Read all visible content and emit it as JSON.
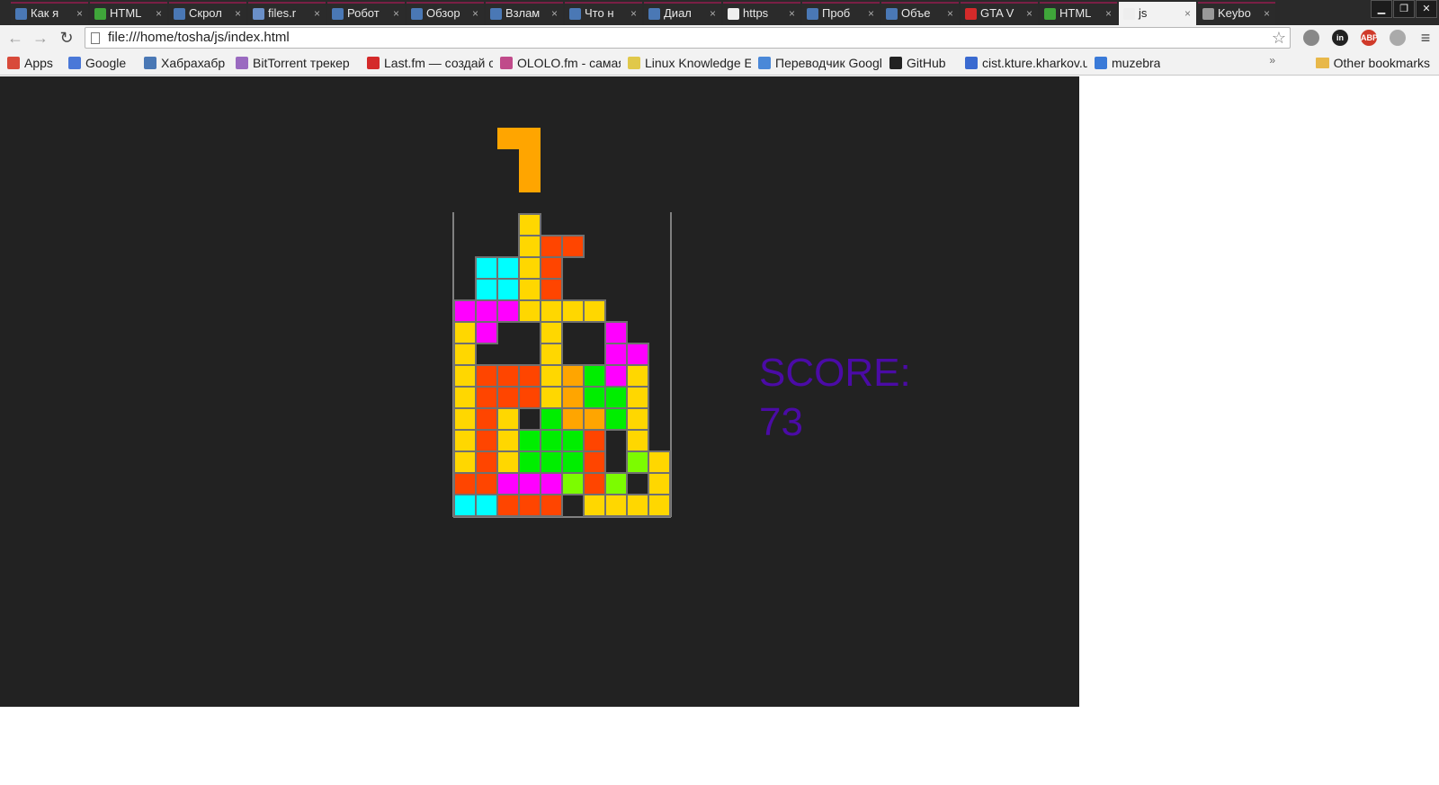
{
  "browser": {
    "tabs": [
      {
        "label": "Как я",
        "icon": "habr-icon",
        "color": "#4a78b5"
      },
      {
        "label": "HTML",
        "icon": "html-icon",
        "color": "#3fa63a"
      },
      {
        "label": "Скрол",
        "icon": "habr-icon",
        "color": "#4a78b5"
      },
      {
        "label": "files.r",
        "icon": "files-icon",
        "color": "#6a8fc7"
      },
      {
        "label": "Робот",
        "icon": "habr-icon",
        "color": "#4a78b5"
      },
      {
        "label": "Обзор",
        "icon": "habr-icon",
        "color": "#4a78b5"
      },
      {
        "label": "Взлам",
        "icon": "habr-icon",
        "color": "#4a78b5"
      },
      {
        "label": "Что н",
        "icon": "habr-icon",
        "color": "#4a78b5"
      },
      {
        "label": "Диал",
        "icon": "trello-icon",
        "color": "#4a78b5"
      },
      {
        "label": "https",
        "icon": "page-icon",
        "color": "#eeeeee"
      },
      {
        "label": "Проб",
        "icon": "habr-icon",
        "color": "#4a78b5"
      },
      {
        "label": "Объе",
        "icon": "habr-icon",
        "color": "#4a78b5"
      },
      {
        "label": "GTA V",
        "icon": "youtube-icon",
        "color": "#d42a2a"
      },
      {
        "label": "HTML",
        "icon": "html-icon",
        "color": "#3fa63a"
      },
      {
        "label": "js",
        "icon": "page-icon",
        "color": "#eeeeee",
        "active": true
      },
      {
        "label": "Keybo",
        "icon": "book-icon",
        "color": "#999999"
      }
    ],
    "url": "file:///home/tosha/js/index.html",
    "bookmarks": [
      {
        "label": "Apps",
        "icon": "apps-icon",
        "color": "#d84a3a"
      },
      {
        "label": "Google",
        "icon": "google-icon",
        "color": "#4a78d8"
      },
      {
        "label": "Хабрахабр",
        "icon": "habr-icon",
        "color": "#4a78b5"
      },
      {
        "label": "BitTorrent трекер",
        "icon": "torrent-icon",
        "color": "#9a6ac0"
      },
      {
        "label": "Last.fm — создай с",
        "icon": "lastfm-icon",
        "color": "#d42a2a"
      },
      {
        "label": "OLOLO.fm - самая",
        "icon": "ololo-icon",
        "color": "#c04a8a"
      },
      {
        "label": "Linux Knowledge E",
        "icon": "document-icon",
        "color": "#e0c84a"
      },
      {
        "label": "Переводчик Googl",
        "icon": "translate-icon",
        "color": "#4a88d8"
      },
      {
        "label": "GitHub",
        "icon": "github-icon",
        "color": "#222222"
      },
      {
        "label": "cist.kture.kharkov.u",
        "icon": "cist-icon",
        "color": "#3a6ad0"
      },
      {
        "label": "muzebra",
        "icon": "muzebra-icon",
        "color": "#3a7ad8"
      }
    ],
    "other_bookmarks": "Other bookmarks",
    "bookmarks_label": "Apps",
    "extensions": [
      {
        "name": "ghostery-icon",
        "text": "",
        "color": "#888888"
      },
      {
        "name": "linkedin-icon",
        "text": "in",
        "color": "#222222"
      },
      {
        "name": "adblock-icon",
        "text": "ABP",
        "color": "#d03a2a"
      },
      {
        "name": "ghost-icon",
        "text": "",
        "color": "#aaaaaa"
      }
    ]
  },
  "game": {
    "score_label": "SCORE:",
    "score_value": "73",
    "colors": {
      "Y": "#ffd700",
      "R": "#ff4500",
      "O": "#ffa500",
      "G": "#00ee00",
      "L": "#7cfc00",
      "M": "#ff00ff",
      "C": "#00ffff",
      "well_border": "#808080",
      "cell_stroke": "#707070",
      "score": "#4b0ba6",
      "background": "#222222"
    },
    "board": [
      "..........",
      "..........",
      "..........",
      "..........",
      "..........",
      "..........",
      "..........",
      "...Y......",
      "...YRR....",
      ".CCYR.....",
      ".CCYR.....",
      "MMMYYYY...",
      "YM..Y..M..",
      "Y...Y..MM.",
      "YRRRYOGMY.",
      "YRRRYOGGY.",
      "YRY.GOOGY.",
      "YRYGGGR.Y.",
      "YRYGGGR.LY",
      "RRMMMLRL.Y",
      "CCRRR.YYYY"
    ],
    "falling_piece": {
      "type": "J",
      "color": "O",
      "cells": [
        [
          2,
          3
        ],
        [
          3,
          3
        ],
        [
          3,
          4
        ],
        [
          3,
          5
        ]
      ]
    }
  }
}
